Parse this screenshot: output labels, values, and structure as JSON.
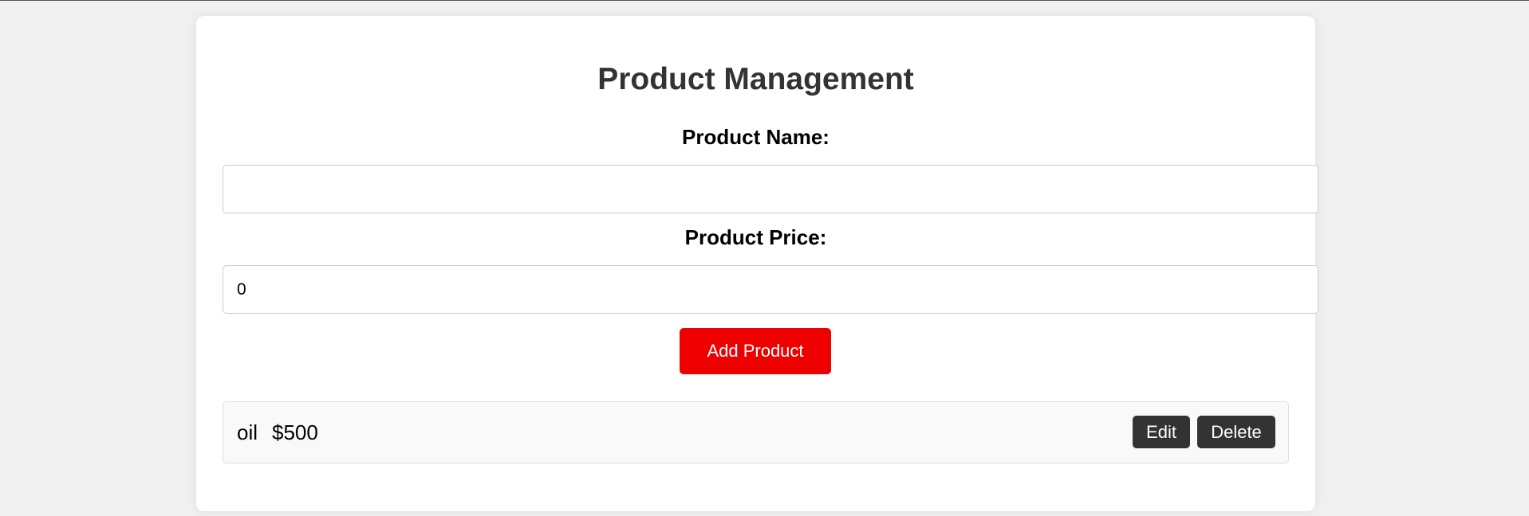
{
  "page": {
    "title": "Product Management"
  },
  "form": {
    "name_label": "Product Name:",
    "name_value": "",
    "price_label": "Product Price:",
    "price_value": "0",
    "add_button_label": "Add Product"
  },
  "products": [
    {
      "name": "oil",
      "price": "$500",
      "edit_label": "Edit",
      "delete_label": "Delete"
    }
  ],
  "colors": {
    "background": "#f0f0f0",
    "card": "#ffffff",
    "add_button": "#ee0000",
    "row_button": "#333333",
    "row_background": "#f9f9f9"
  }
}
